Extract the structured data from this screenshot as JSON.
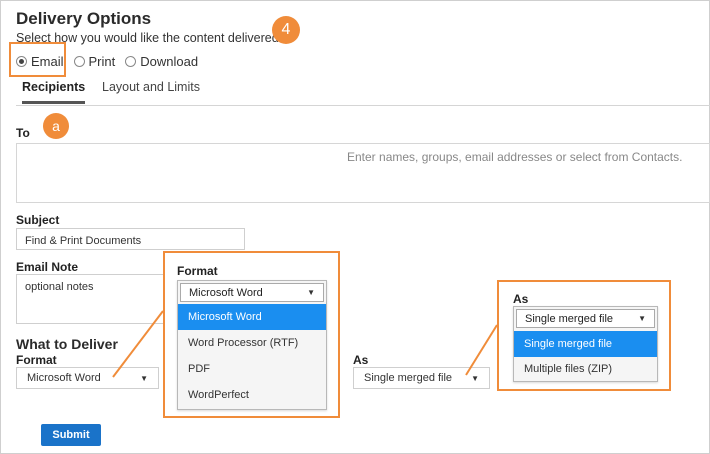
{
  "header": {
    "title": "Delivery Options",
    "subtitle": "Select how you would like the content delivered.",
    "callout_number": "4",
    "callout_letter": "a"
  },
  "delivery_methods": [
    {
      "label": "Email",
      "selected": true
    },
    {
      "label": "Print",
      "selected": false
    },
    {
      "label": "Download",
      "selected": false
    }
  ],
  "tabs": [
    {
      "label": "Recipients",
      "active": true
    },
    {
      "label": "Layout and Limits",
      "active": false
    }
  ],
  "form": {
    "to_label": "To",
    "to_placeholder": "Enter names, groups, email addresses or select from Contacts.",
    "subject_label": "Subject",
    "subject_value": "Find & Print Documents",
    "note_label": "Email Note",
    "note_value": "optional notes",
    "what_to_deliver": "What to Deliver",
    "format_label": "Format",
    "format_value": "Microsoft Word",
    "as_label": "As",
    "as_value": "Single merged file",
    "submit_label": "Submit"
  },
  "format_dropdown": {
    "title": "Format",
    "selected": "Microsoft Word",
    "options": [
      "Microsoft Word",
      "Word Processor (RTF)",
      "PDF",
      "WordPerfect"
    ]
  },
  "as_dropdown": {
    "title": "As",
    "selected": "Single merged file",
    "options": [
      "Single merged file",
      "Multiple files (ZIP)"
    ]
  },
  "colors": {
    "accent_orange": "#f08c3a",
    "selected_blue": "#1a8ef0",
    "button_blue": "#1a73c9"
  }
}
